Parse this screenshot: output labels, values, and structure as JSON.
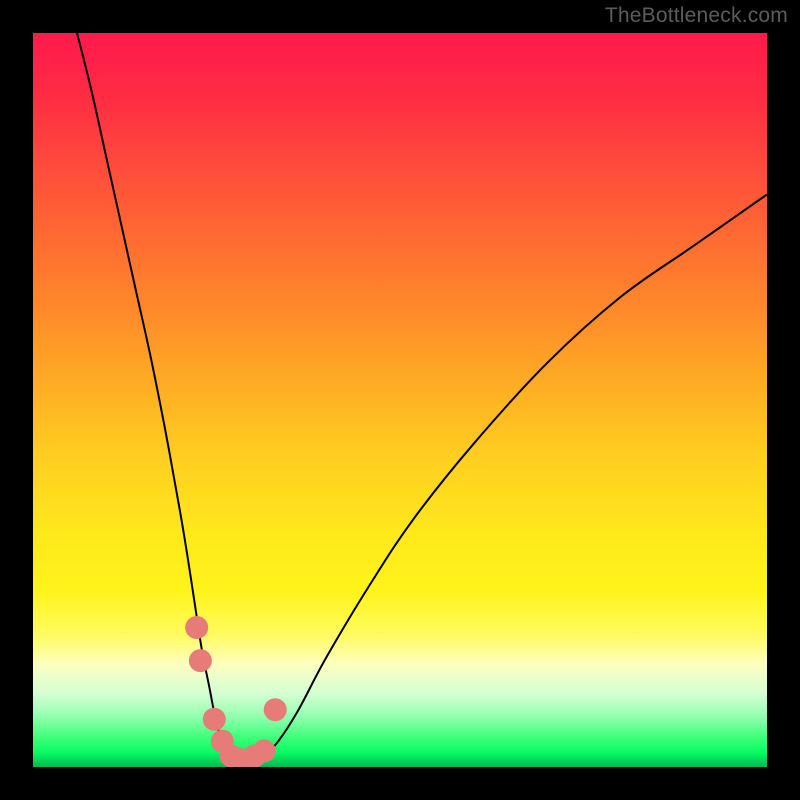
{
  "watermark": {
    "text": "TheBottleneck.com"
  },
  "colors": {
    "background": "#000000",
    "curve": "#000000",
    "marker": "#e77b78",
    "gradient_top": "#ff1a4c",
    "gradient_bottom": "#06b84e"
  },
  "chart_data": {
    "type": "line",
    "title": "",
    "xlabel": "",
    "ylabel": "",
    "xlim": [
      0,
      100
    ],
    "ylim": [
      0,
      100
    ],
    "grid": false,
    "legend": false,
    "series": [
      {
        "name": "bottleneck-curve",
        "x": [
          6,
          8,
          10,
          12,
          14,
          16,
          18,
          20,
          21,
          22,
          23,
          24,
          25,
          26,
          27,
          28,
          29,
          30,
          31,
          33,
          36,
          40,
          46,
          52,
          60,
          70,
          80,
          90,
          100
        ],
        "values": [
          100,
          92,
          83,
          74,
          65,
          56,
          46,
          35,
          29,
          22.5,
          16,
          11,
          6,
          3,
          1.5,
          1,
          1,
          1,
          1.5,
          3,
          7.5,
          15,
          25,
          34,
          44,
          55,
          64,
          71,
          78
        ]
      }
    ],
    "markers": {
      "name": "highlight-points",
      "x": [
        22.3,
        22.8,
        24.7,
        25.8,
        27.0,
        28.3,
        29.4,
        30.2,
        31.5,
        33.0
      ],
      "values": [
        19.0,
        14.5,
        6.5,
        3.5,
        1.5,
        1.0,
        1.0,
        1.5,
        2.2,
        7.8
      ]
    }
  }
}
